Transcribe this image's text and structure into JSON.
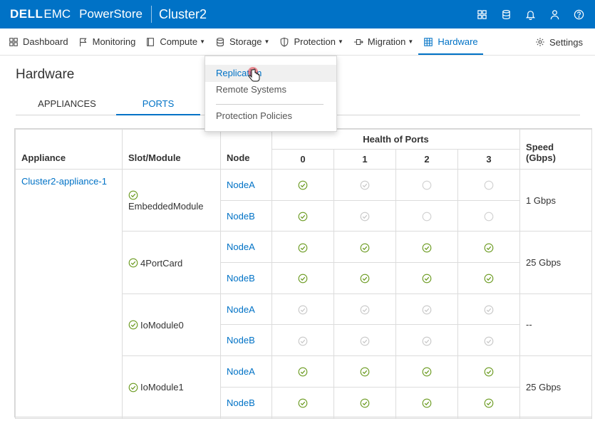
{
  "header": {
    "brand_dell": "DELL",
    "brand_emc": "EMC",
    "product": "PowerStore",
    "cluster": "Cluster2",
    "icons": [
      "grid-icon",
      "database-icon",
      "bell-icon",
      "user-icon",
      "help-icon"
    ],
    "color": "#0072c6"
  },
  "nav": {
    "dashboard": "Dashboard",
    "monitoring": "Monitoring",
    "compute": "Compute",
    "storage": "Storage",
    "protection": "Protection",
    "migration": "Migration",
    "hardware": "Hardware",
    "settings": "Settings"
  },
  "page": {
    "title": "Hardware",
    "tabs": [
      "APPLIANCES",
      "PORTS"
    ],
    "active_tab": "PORTS"
  },
  "protection_menu": {
    "items": [
      "Replication",
      "Remote Systems",
      "Protection Policies"
    ],
    "hovered": "Replication"
  },
  "table": {
    "headers": {
      "appliance": "Appliance",
      "slot": "Slot/Module",
      "node": "Node",
      "health": "Health of Ports",
      "ports": [
        "0",
        "1",
        "2",
        "3"
      ],
      "speed": "Speed (Gbps)"
    },
    "appliance": "Cluster2-appliance-1",
    "modules": [
      {
        "name": "EmbeddedModule",
        "speed": "1 Gbps",
        "nodes": [
          {
            "node": "NodeA",
            "ports": [
              "ok",
              "inactive",
              "empty",
              "empty"
            ]
          },
          {
            "node": "NodeB",
            "ports": [
              "ok",
              "inactive",
              "empty",
              "empty"
            ]
          }
        ]
      },
      {
        "name": "4PortCard",
        "speed": "25 Gbps",
        "nodes": [
          {
            "node": "NodeA",
            "ports": [
              "ok",
              "ok",
              "ok",
              "ok"
            ]
          },
          {
            "node": "NodeB",
            "ports": [
              "ok",
              "ok",
              "ok",
              "ok"
            ]
          }
        ]
      },
      {
        "name": "IoModule0",
        "speed": "--",
        "nodes": [
          {
            "node": "NodeA",
            "ports": [
              "inactive",
              "inactive",
              "inactive",
              "inactive"
            ]
          },
          {
            "node": "NodeB",
            "ports": [
              "inactive",
              "inactive",
              "inactive",
              "inactive"
            ]
          }
        ]
      },
      {
        "name": "IoModule1",
        "speed": "25 Gbps",
        "nodes": [
          {
            "node": "NodeA",
            "ports": [
              "ok",
              "ok",
              "ok",
              "ok"
            ]
          },
          {
            "node": "NodeB",
            "ports": [
              "ok",
              "ok",
              "ok",
              "ok"
            ]
          }
        ]
      }
    ],
    "status_colors": {
      "ok": "#6a9a1f",
      "inactive": "#c8c8c8",
      "empty": "#d0d0d0"
    }
  }
}
